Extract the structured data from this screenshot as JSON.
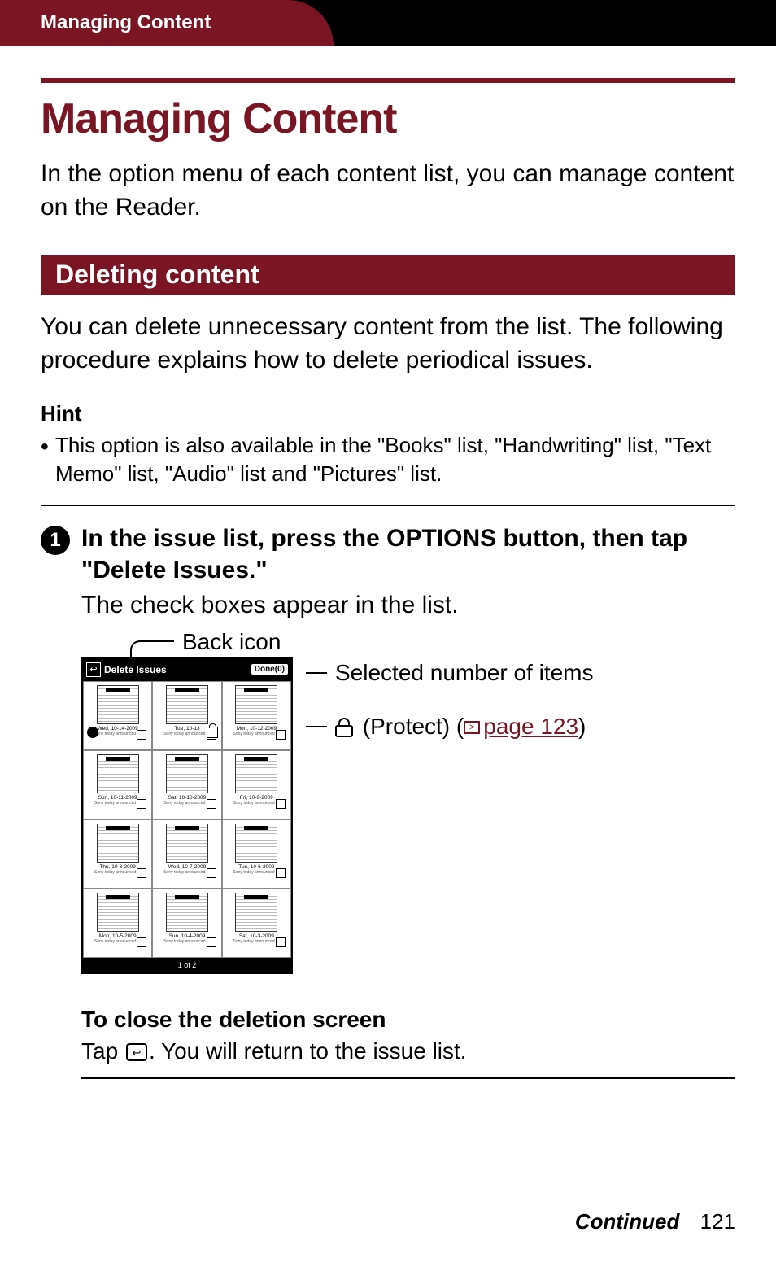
{
  "header": {
    "breadcrumb": "Managing Content"
  },
  "title": "Managing Content",
  "intro": "In the option menu of each content list, you can manage content on the Reader.",
  "section": {
    "heading": "Deleting content",
    "description": "You can delete unnecessary content from the list. The following procedure explains how to delete periodical issues."
  },
  "hint": {
    "label": "Hint",
    "items": [
      "This option is also available in the \"Books\" list, \"Handwriting\" list, \"Text Memo\" list, \"Audio\" list and \"Pictures\" list."
    ]
  },
  "step1": {
    "number": "1",
    "title": "In the issue list, press the OPTIONS button, then tap \"Delete Issues.\"",
    "subtitle": "The check boxes appear in the list."
  },
  "callouts": {
    "back": "Back icon",
    "selected": "Selected number of items",
    "protect_label": "(Protect) (",
    "protect_xref": "page 123",
    "protect_close": ")"
  },
  "screenshot": {
    "top_title": "Delete Issues",
    "done": "Done(0)",
    "pager": "1 of 2",
    "sub": "Sony today announced …",
    "cells": [
      {
        "date": "Wed, 10-14-2009",
        "badge": true,
        "lock": false
      },
      {
        "date": "Tue, 10-13",
        "badge": false,
        "lock": true
      },
      {
        "date": "Mon, 10-12-2009",
        "badge": false,
        "lock": false
      },
      {
        "date": "Sun, 10-11-2009",
        "badge": false,
        "lock": false
      },
      {
        "date": "Sat, 10-10-2009",
        "badge": false,
        "lock": false
      },
      {
        "date": "Fri, 10-9-2009",
        "badge": false,
        "lock": false
      },
      {
        "date": "Thu, 10-8-2009",
        "badge": false,
        "lock": false
      },
      {
        "date": "Wed, 10-7-2009",
        "badge": false,
        "lock": false
      },
      {
        "date": "Tue, 10-6-2009",
        "badge": false,
        "lock": false
      },
      {
        "date": "Mon, 10-5-2009",
        "badge": false,
        "lock": false
      },
      {
        "date": "Sun, 10-4-2009",
        "badge": false,
        "lock": false
      },
      {
        "date": "Sat, 10-3-2009",
        "badge": false,
        "lock": false
      }
    ]
  },
  "subsection": {
    "title": "To close the deletion screen",
    "body_pre": "Tap ",
    "body_post": ". You will return to the issue list."
  },
  "footer": {
    "continued": "Continued",
    "page": "121"
  }
}
